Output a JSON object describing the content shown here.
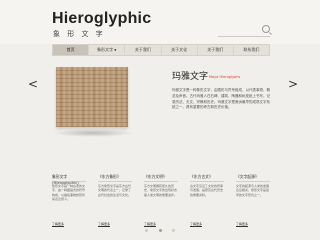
{
  "header": {
    "title": "Hieroglyphic",
    "subtitle": "象 形 文 字"
  },
  "nav": {
    "items": [
      {
        "label": "首页",
        "active": true,
        "has_dropdown": false
      },
      {
        "label": "象形文字",
        "active": false,
        "has_dropdown": true
      },
      {
        "label": "关于我们",
        "active": false,
        "has_dropdown": false
      },
      {
        "label": "关于文化",
        "active": false,
        "has_dropdown": false
      },
      {
        "label": "关于我们",
        "active": false,
        "has_dropdown": false
      },
      {
        "label": "联系我们",
        "active": false,
        "has_dropdown": false
      }
    ]
  },
  "slider": {
    "title": "玛雅文字",
    "title_en": "Maya Hieroglyphs",
    "text": "玛雅文字是一种象形文字，由图形与符号组成，以代表事物、概念及声音。古代玛雅人在石碑、建筑、陶器和树皮纸上书写，记录历法、天文、宗教和历史。玛雅文字是美洲最早的成熟文字系统之一，具有重要的考古和历史价值。",
    "prev_arrow": "<",
    "next_arrow": ">"
  },
  "cards": [
    {
      "title": "象形文字",
      "subtitle": "(Hieroglyphic)",
      "text": "象形文字是一种古老的文字，由一种图画式的符号构成，以描绘事物的形状来表达意义。",
      "more": "了解更多"
    },
    {
      "title": "《东方象形》",
      "subtitle": "",
      "text": "东方象形文字是东方古代文明的代表之一，记录了古代社会的生活与文化。",
      "more": "了解更多"
    },
    {
      "title": "《东方文明》",
      "subtitle": "",
      "text": "东方文明拥有悠久的历史，象形文字的出现标志着人类文明的重要进步。",
      "more": "了解更多"
    },
    {
      "title": "《东方古文》",
      "subtitle": "",
      "text": "古文字见证了文化的传承与发展，是研究古代历史的重要资料。",
      "more": "了解更多"
    },
    {
      "title": "《文字起源》",
      "subtitle": "",
      "text": "文字的起源与人类的发展息息相关，象形文字是最早的文字形式之一。",
      "more": "了解更多"
    }
  ],
  "pagination": {
    "count": 3,
    "active_index": 1
  }
}
